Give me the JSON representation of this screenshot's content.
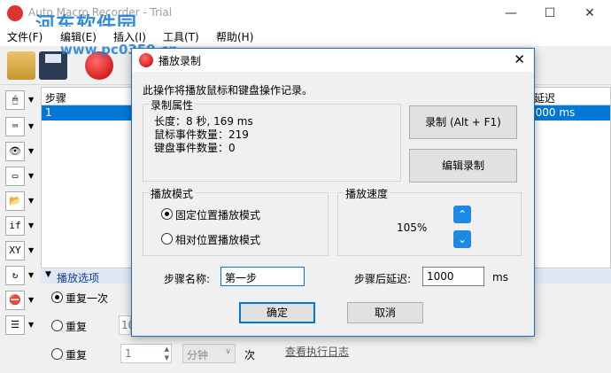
{
  "window": {
    "title": "Auto Macro Recorder - Trial"
  },
  "watermark": {
    "line1": "河东软件园",
    "line2": "www.pc0359.cn"
  },
  "menu": [
    "文件(F)",
    "编辑(E)",
    "插入(I)",
    "工具(T)",
    "帮助(H)"
  ],
  "grid": {
    "columns": [
      "步骤",
      "延迟"
    ],
    "rows": [
      {
        "step": "1",
        "delay": "1000 ms"
      }
    ]
  },
  "options": {
    "header": "播放选项",
    "repeat_once": "重复一次",
    "repeat": "重复",
    "repeat_count_value": "10",
    "repeat_for": "重复",
    "spin_value": "1",
    "unit_combo": "分钟",
    "times_label": "次",
    "log_link": "查看执行日志"
  },
  "dialog": {
    "title": "播放录制",
    "description": "此操作将播放鼠标和键盘操作记录。",
    "properties_group": "录制属性",
    "length": "长度：8 秒, 169 ms",
    "mouse_events": "鼠标事件数量：219",
    "key_events": "键盘事件数量：0",
    "record_button": "录制 (Alt + F1)",
    "edit_button": "编辑录制",
    "mode_group": "播放模式",
    "mode_fixed": "固定位置播放模式",
    "mode_relative": "相对位置播放模式",
    "speed_group": "播放速度",
    "speed_value": "105%",
    "step_name_label": "步骤名称:",
    "step_name_value": "第一步",
    "delay_label": "步骤后延迟:",
    "delay_value": "1000",
    "delay_unit": "ms",
    "ok_button": "确定",
    "cancel_button": "取消"
  }
}
